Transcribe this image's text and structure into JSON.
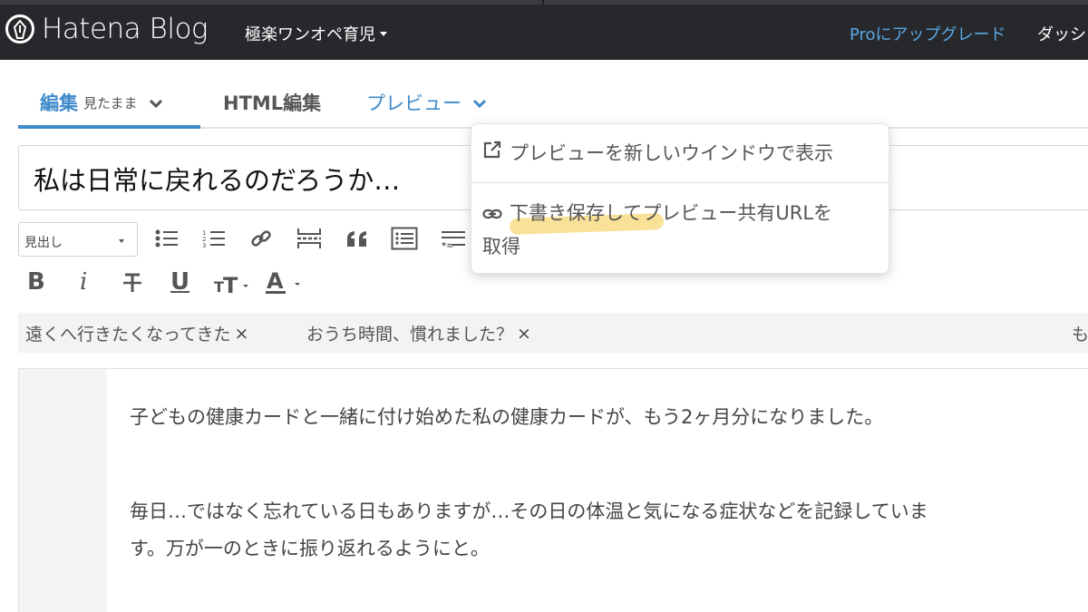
{
  "header": {
    "logo_text": "Hatena Blog",
    "blog_name": "極楽ワンオペ育児",
    "upgrade_link": "Proにアップグレード",
    "dashboard_link": "ダッシ"
  },
  "tabs": {
    "edit_label": "編集",
    "edit_mode": "見たまま",
    "html_label": "HTML編集",
    "preview_label": "プレビュー"
  },
  "preview_menu": {
    "open_new_window": "プレビューを新しいウインドウで表示",
    "share_url_line1": "下書き保存してプレビュー共有URLを",
    "share_url_line2": "取得"
  },
  "editor": {
    "title": "私は日常に戻れるのだろうか…",
    "heading_select_value": "見出し",
    "toolbar": {
      "bold": "B",
      "italic": "i",
      "underline": "U"
    },
    "tags": [
      {
        "label": "遠くへ行きたくなってきた",
        "remove": "×"
      },
      {
        "label": "おうち時間、慣れました？",
        "remove": "×"
      }
    ],
    "tag_overflow": "も",
    "paragraphs": [
      "子どもの健康カードと一緒に付け始めた私の健康カードが、もう2ヶ月分になりました。",
      "毎日…ではなく忘れている日もありますが…その日の体温と気になる症状などを記録していま",
      "す。万が一のときに振り返れるようにと。"
    ]
  },
  "colors": {
    "topbar": "#26282b",
    "accent_blue": "#3f8ac9",
    "upgrade_blue": "#5aa7e6",
    "highlight_yellow": "#f8dc86"
  },
  "icons": [
    "hatena-logo-icon",
    "chevron-down-icon",
    "list-bullet-icon",
    "list-numbered-icon",
    "link-icon",
    "more-break-icon",
    "quote-icon",
    "table-of-contents-icon",
    "footnote-icon",
    "strikethrough-icon",
    "text-size-icon",
    "text-color-icon",
    "external-link-icon",
    "share-link-icon"
  ]
}
